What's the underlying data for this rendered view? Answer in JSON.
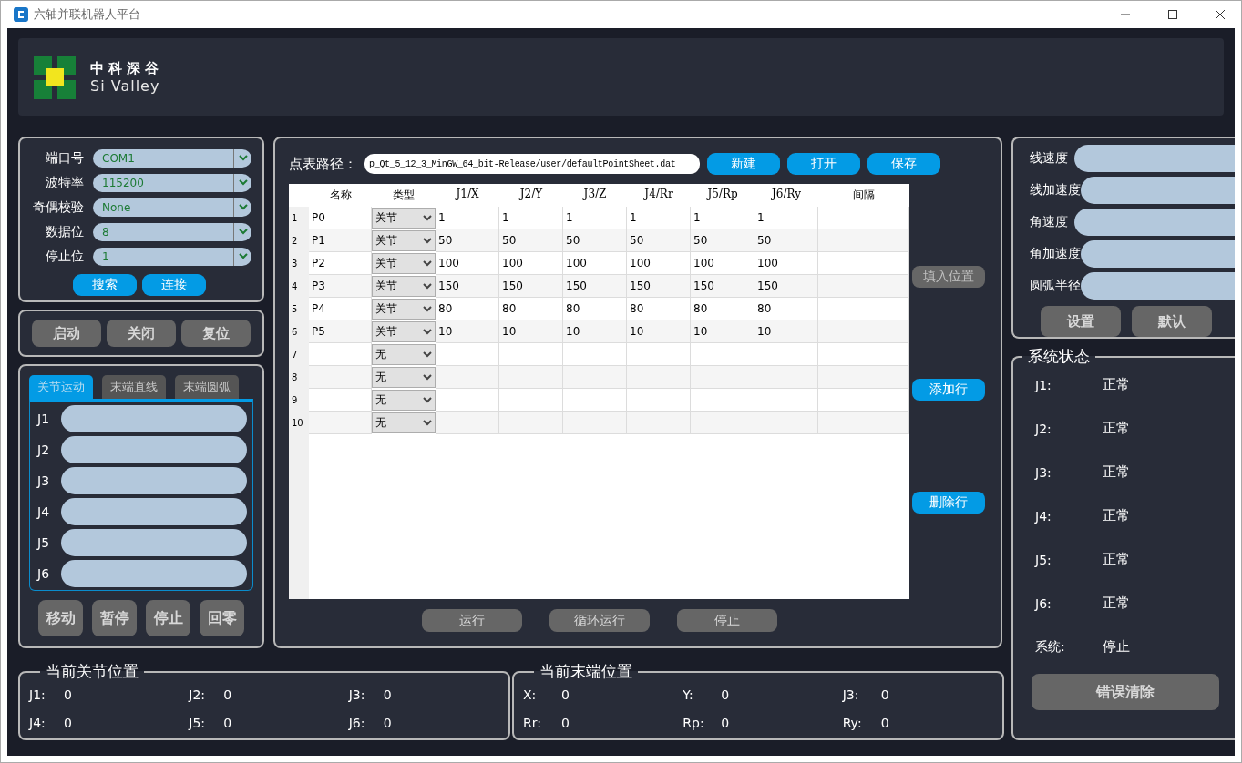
{
  "window": {
    "title": "六轴并联机器人平台"
  },
  "header": {
    "logo_cn": "中科深谷",
    "logo_en": "Si Valley"
  },
  "serial": {
    "fields": [
      {
        "label": "端口号",
        "value": "COM1"
      },
      {
        "label": "波特率",
        "value": "115200"
      },
      {
        "label": "奇偶校验",
        "value": "None"
      },
      {
        "label": "数据位",
        "value": "8"
      },
      {
        "label": "停止位",
        "value": "1"
      }
    ],
    "buttons": [
      "搜索",
      "连接"
    ]
  },
  "power_buttons": [
    "启动",
    "关闭",
    "复位"
  ],
  "motion": {
    "tabs": [
      {
        "label": "关节运动",
        "selected": true
      },
      {
        "label": "末端直线",
        "selected": false
      },
      {
        "label": "末端圆弧",
        "selected": false
      }
    ],
    "joints": [
      "J1",
      "J2",
      "J3",
      "J4",
      "J5",
      "J6"
    ],
    "buttons": [
      "移动",
      "暂停",
      "停止",
      "回零"
    ]
  },
  "point_table": {
    "path_label": "点表路径：",
    "path_value": "p_Qt_5_12_3_MinGW_64_bit-Release/user/defaultPointSheet.dat",
    "buttons": [
      "新建",
      "打开",
      "保存"
    ],
    "columns": [
      "名称",
      "类型",
      "J1/X",
      "J2/Y",
      "J3/Z",
      "J4/Rr",
      "J5/Rp",
      "J6/Ry",
      "间隔"
    ],
    "rows": [
      {
        "index": "1",
        "name": "P0",
        "type": "关节",
        "values": [
          "1",
          "1",
          "1",
          "1",
          "1",
          "1"
        ]
      },
      {
        "index": "2",
        "name": "P1",
        "type": "关节",
        "values": [
          "50",
          "50",
          "50",
          "50",
          "50",
          "50"
        ]
      },
      {
        "index": "3",
        "name": "P2",
        "type": "关节",
        "values": [
          "100",
          "100",
          "100",
          "100",
          "100",
          "100"
        ]
      },
      {
        "index": "4",
        "name": "P3",
        "type": "关节",
        "values": [
          "150",
          "150",
          "150",
          "150",
          "150",
          "150"
        ]
      },
      {
        "index": "5",
        "name": "P4",
        "type": "关节",
        "values": [
          "80",
          "80",
          "80",
          "80",
          "80",
          "80"
        ]
      },
      {
        "index": "6",
        "name": "P5",
        "type": "关节",
        "values": [
          "10",
          "10",
          "10",
          "10",
          "10",
          "10"
        ]
      },
      {
        "index": "7",
        "type": "无"
      },
      {
        "index": "8",
        "type": "无"
      },
      {
        "index": "9",
        "type": "无"
      },
      {
        "index": "10",
        "type": "无"
      }
    ],
    "side_buttons": [
      {
        "label": "填入位置",
        "disabled": true
      },
      {
        "label": "添加行",
        "disabled": false
      },
      {
        "label": "删除行",
        "disabled": false
      }
    ],
    "run_buttons": [
      "运行",
      "循环运行",
      "停止"
    ]
  },
  "params": {
    "fields": [
      "线速度",
      "线加速度",
      "角速度",
      "角加速度",
      "圆弧半径"
    ],
    "buttons": [
      "设置",
      "默认"
    ]
  },
  "system_status": {
    "title": "系统状态",
    "items": [
      {
        "label": "J1:",
        "value": "正常"
      },
      {
        "label": "J2:",
        "value": "正常"
      },
      {
        "label": "J3:",
        "value": "正常"
      },
      {
        "label": "J4:",
        "value": "正常"
      },
      {
        "label": "J5:",
        "value": "正常"
      },
      {
        "label": "J6:",
        "value": "正常"
      },
      {
        "label": "系统:",
        "value": "停止"
      }
    ],
    "clear_button": "错误清除"
  },
  "joint_position": {
    "title": "当前关节位置",
    "items": [
      {
        "label": "J1:",
        "value": "0"
      },
      {
        "label": "J2:",
        "value": "0"
      },
      {
        "label": "J3:",
        "value": "0"
      },
      {
        "label": "J4:",
        "value": "0"
      },
      {
        "label": "J5:",
        "value": "0"
      },
      {
        "label": "J6:",
        "value": "0"
      }
    ]
  },
  "end_position": {
    "title": "当前末端位置",
    "items": [
      {
        "label": "X:",
        "value": "0"
      },
      {
        "label": "Y:",
        "value": "0"
      },
      {
        "label": "J3:",
        "value": "0"
      },
      {
        "label": "Rr:",
        "value": "0"
      },
      {
        "label": "Rp:",
        "value": "0"
      },
      {
        "label": "Ry:",
        "value": "0"
      }
    ]
  }
}
